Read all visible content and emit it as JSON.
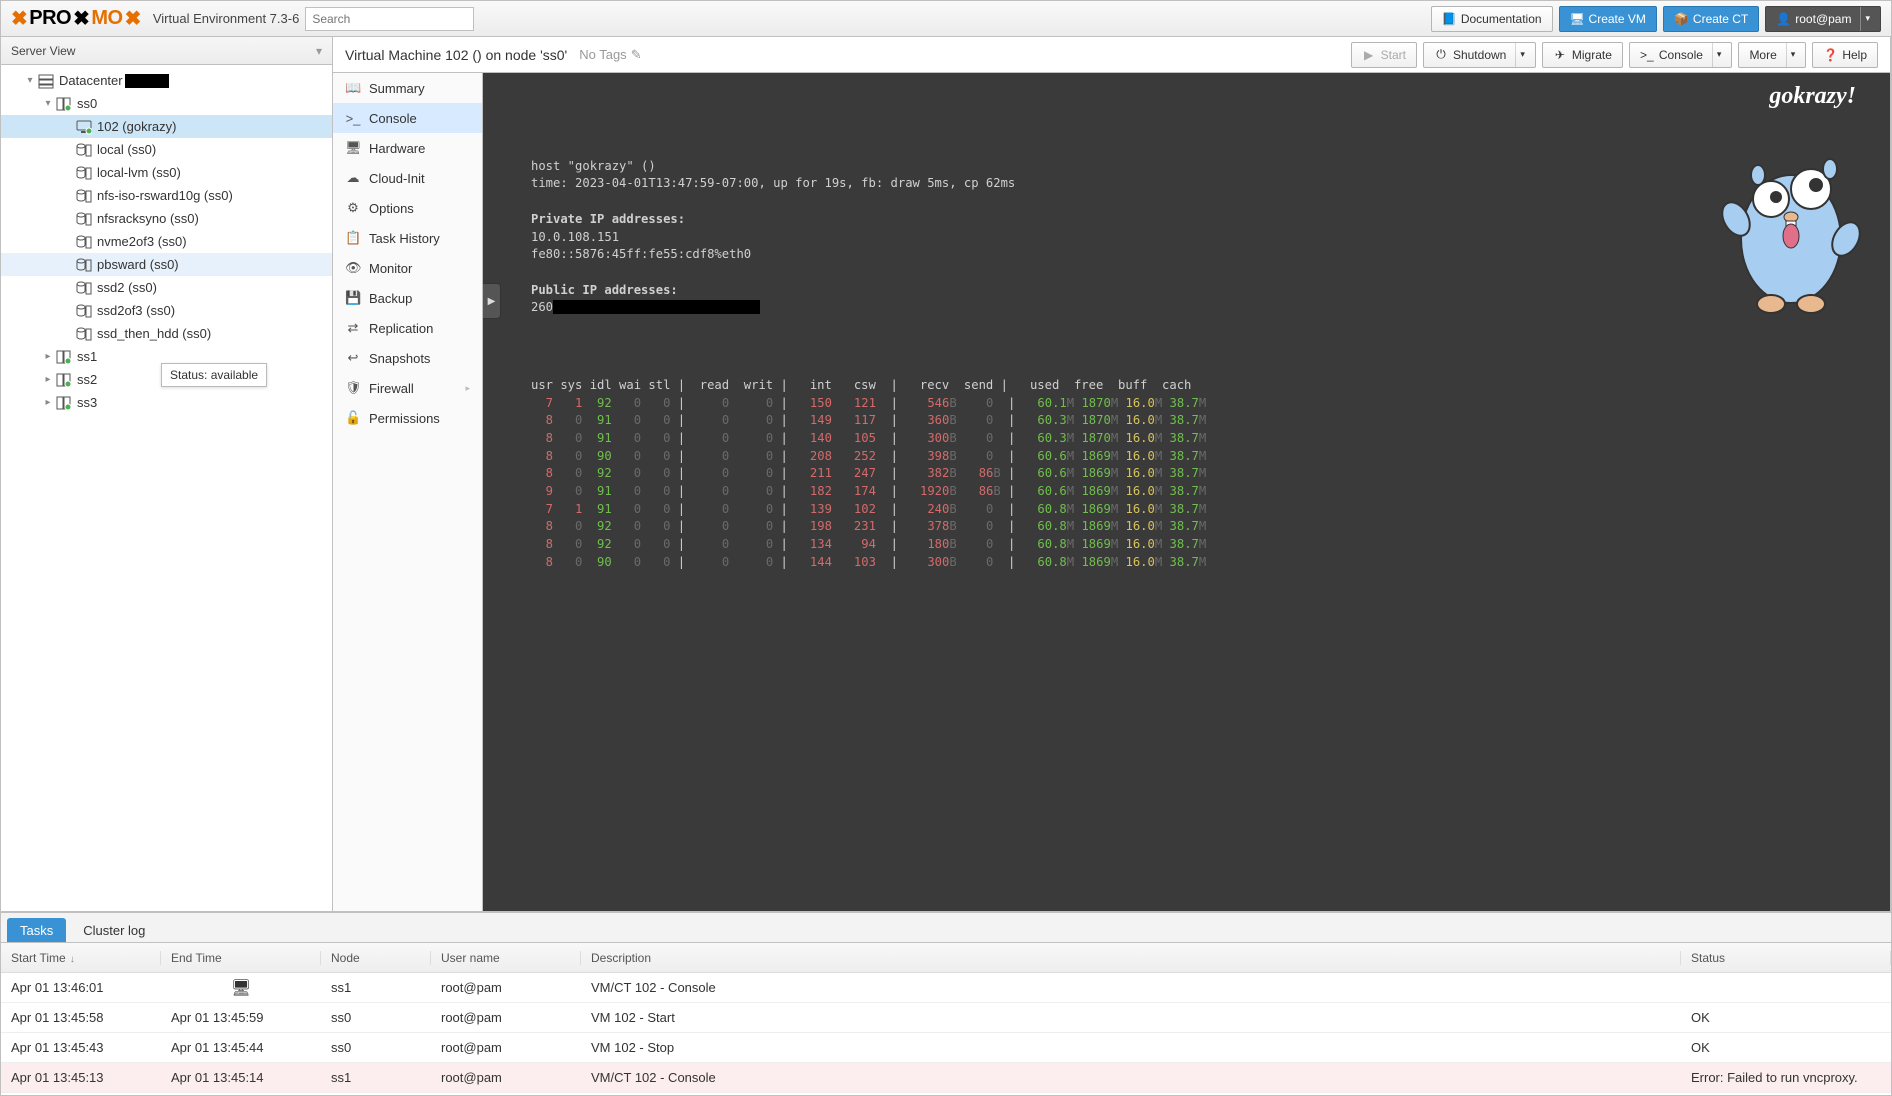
{
  "topbar": {
    "brand_pro": "PRO",
    "brand_mo": "MO",
    "sub": "Virtual Environment 7.3-6",
    "search_placeholder": "Search",
    "doc_btn": "Documentation",
    "create_vm": "Create VM",
    "create_ct": "Create CT",
    "user_btn": "root@pam"
  },
  "leftpane": {
    "header": "Server View",
    "tooltip": "Status: available",
    "tree": [
      {
        "level": 1,
        "expand": "▾",
        "icon": "datacenter",
        "label": "Datacenter",
        "redact": true
      },
      {
        "level": 2,
        "expand": "▾",
        "icon": "node",
        "label": "ss0",
        "hl": false
      },
      {
        "level": 3,
        "expand": "",
        "icon": "vm",
        "label": "102 (gokrazy)",
        "sel": true
      },
      {
        "level": 3,
        "expand": "",
        "icon": "storage",
        "label": "local (ss0)"
      },
      {
        "level": 3,
        "expand": "",
        "icon": "storage",
        "label": "local-lvm (ss0)"
      },
      {
        "level": 3,
        "expand": "",
        "icon": "storage",
        "label": "nfs-iso-rsward10g (ss0)"
      },
      {
        "level": 3,
        "expand": "",
        "icon": "storage",
        "label": "nfsracksyno (ss0)"
      },
      {
        "level": 3,
        "expand": "",
        "icon": "storage",
        "label": "nvme2of3 (ss0)"
      },
      {
        "level": 3,
        "expand": "",
        "icon": "storage",
        "label": "pbsward (ss0)",
        "hl": true
      },
      {
        "level": 3,
        "expand": "",
        "icon": "storage",
        "label": "ssd2 (ss0)"
      },
      {
        "level": 3,
        "expand": "",
        "icon": "storage",
        "label": "ssd2of3 (ss0)"
      },
      {
        "level": 3,
        "expand": "",
        "icon": "storage",
        "label": "ssd_then_hdd (ss0)"
      },
      {
        "level": 2,
        "expand": "▸",
        "icon": "node",
        "label": "ss1"
      },
      {
        "level": 2,
        "expand": "▸",
        "icon": "node",
        "label": "ss2"
      },
      {
        "level": 2,
        "expand": "▸",
        "icon": "node",
        "label": "ss3"
      }
    ]
  },
  "centerheader": {
    "title": "Virtual Machine 102 () on node 'ss0'",
    "tags": "No Tags",
    "actions": {
      "start": "Start",
      "shutdown": "Shutdown",
      "migrate": "Migrate",
      "console": "Console",
      "more": "More",
      "help": "Help"
    }
  },
  "subnav": [
    {
      "icon": "📖",
      "label": "Summary"
    },
    {
      "icon": ">_",
      "label": "Console",
      "sel": true
    },
    {
      "icon": "🖥",
      "label": "Hardware"
    },
    {
      "icon": "☁",
      "label": "Cloud-Init"
    },
    {
      "icon": "⚙",
      "label": "Options"
    },
    {
      "icon": "📋",
      "label": "Task History"
    },
    {
      "icon": "👁",
      "label": "Monitor"
    },
    {
      "icon": "💾",
      "label": "Backup"
    },
    {
      "icon": "⇄",
      "label": "Replication"
    },
    {
      "icon": "↩",
      "label": "Snapshots"
    },
    {
      "icon": "🛡",
      "label": "Firewall",
      "caret": true
    },
    {
      "icon": "🔓",
      "label": "Permissions"
    }
  ],
  "console": {
    "brand": "gokrazy!",
    "host_line": "host \"gokrazy\" ()",
    "time_line": "time: 2023-04-01T13:47:59-07:00, up for 19s, fb: draw 5ms, cp 62ms",
    "priv_hdr": "Private IP addresses:",
    "priv_ip1": "10.0.108.151",
    "priv_ip2": "fe80::5876:45ff:fe55:cdf8%eth0",
    "pub_hdr": "Public IP addresses:",
    "pub_ip1_prefix": "260",
    "stats_header": "usr sys idl wai stl |  read  writ |   int   csw  |   recv  send |   used  free  buff  cach",
    "rows": [
      {
        "usr": "7",
        "sys": "1",
        "idl": "92",
        "wai": "0",
        "stl": "0",
        "read": "0",
        "writ": "0",
        "int": "150",
        "csw": "121",
        "recv": "546",
        "recvB": "B",
        "send": "0",
        "used": "60.1",
        "usedM": "M",
        "free": "1870",
        "freeM": "M",
        "buff": "16.0",
        "buffM": "M",
        "cach": "38.7",
        "cachM": "M"
      },
      {
        "usr": "8",
        "sys": "0",
        "idl": "91",
        "wai": "0",
        "stl": "0",
        "read": "0",
        "writ": "0",
        "int": "149",
        "csw": "117",
        "recv": "360",
        "recvB": "B",
        "send": "0",
        "used": "60.3",
        "usedM": "M",
        "free": "1870",
        "freeM": "M",
        "buff": "16.0",
        "buffM": "M",
        "cach": "38.7",
        "cachM": "M"
      },
      {
        "usr": "8",
        "sys": "0",
        "idl": "91",
        "wai": "0",
        "stl": "0",
        "read": "0",
        "writ": "0",
        "int": "140",
        "csw": "105",
        "recv": "300",
        "recvB": "B",
        "send": "0",
        "used": "60.3",
        "usedM": "M",
        "free": "1870",
        "freeM": "M",
        "buff": "16.0",
        "buffM": "M",
        "cach": "38.7",
        "cachM": "M"
      },
      {
        "usr": "8",
        "sys": "0",
        "idl": "90",
        "wai": "0",
        "stl": "0",
        "read": "0",
        "writ": "0",
        "int": "208",
        "csw": "252",
        "recv": "398",
        "recvB": "B",
        "send": "0",
        "used": "60.6",
        "usedM": "M",
        "free": "1869",
        "freeM": "M",
        "buff": "16.0",
        "buffM": "M",
        "cach": "38.7",
        "cachM": "M"
      },
      {
        "usr": "8",
        "sys": "0",
        "idl": "92",
        "wai": "0",
        "stl": "0",
        "read": "0",
        "writ": "0",
        "int": "211",
        "csw": "247",
        "recv": "382",
        "recvB": "B",
        "send": "86",
        "sendB": "B",
        "used": "60.6",
        "usedM": "M",
        "free": "1869",
        "freeM": "M",
        "buff": "16.0",
        "buffM": "M",
        "cach": "38.7",
        "cachM": "M"
      },
      {
        "usr": "9",
        "sys": "0",
        "idl": "91",
        "wai": "0",
        "stl": "0",
        "read": "0",
        "writ": "0",
        "int": "182",
        "csw": "174",
        "recv": "1920",
        "recvB": "B",
        "send": "86",
        "sendB": "B",
        "used": "60.6",
        "usedM": "M",
        "free": "1869",
        "freeM": "M",
        "buff": "16.0",
        "buffM": "M",
        "cach": "38.7",
        "cachM": "M"
      },
      {
        "usr": "7",
        "sys": "1",
        "idl": "91",
        "wai": "0",
        "stl": "0",
        "read": "0",
        "writ": "0",
        "int": "139",
        "csw": "102",
        "recv": "240",
        "recvB": "B",
        "send": "0",
        "used": "60.8",
        "usedM": "M",
        "free": "1869",
        "freeM": "M",
        "buff": "16.0",
        "buffM": "M",
        "cach": "38.7",
        "cachM": "M"
      },
      {
        "usr": "8",
        "sys": "0",
        "idl": "92",
        "wai": "0",
        "stl": "0",
        "read": "0",
        "writ": "0",
        "int": "198",
        "csw": "231",
        "recv": "378",
        "recvB": "B",
        "send": "0",
        "used": "60.8",
        "usedM": "M",
        "free": "1869",
        "freeM": "M",
        "buff": "16.0",
        "buffM": "M",
        "cach": "38.7",
        "cachM": "M"
      },
      {
        "usr": "8",
        "sys": "0",
        "idl": "92",
        "wai": "0",
        "stl": "0",
        "read": "0",
        "writ": "0",
        "int": "134",
        "csw": "94",
        "recv": "180",
        "recvB": "B",
        "send": "0",
        "used": "60.8",
        "usedM": "M",
        "free": "1869",
        "freeM": "M",
        "buff": "16.0",
        "buffM": "M",
        "cach": "38.7",
        "cachM": "M"
      },
      {
        "usr": "8",
        "sys": "0",
        "idl": "90",
        "wai": "0",
        "stl": "0",
        "read": "0",
        "writ": "0",
        "int": "144",
        "csw": "103",
        "recv": "300",
        "recvB": "B",
        "send": "0",
        "used": "60.8",
        "usedM": "M",
        "free": "1869",
        "freeM": "M",
        "buff": "16.0",
        "buffM": "M",
        "cach": "38.7",
        "cachM": "M"
      }
    ]
  },
  "bottom": {
    "tab_tasks": "Tasks",
    "tab_cluster": "Cluster log",
    "cols": {
      "start": "Start Time",
      "end": "End Time",
      "node": "Node",
      "user": "User name",
      "desc": "Description",
      "stat": "Status"
    },
    "rows": [
      {
        "start": "Apr 01 13:46:01",
        "end": "",
        "end_icon": "🖥",
        "node": "ss1",
        "user": "root@pam",
        "desc": "VM/CT 102 - Console",
        "stat": ""
      },
      {
        "start": "Apr 01 13:45:58",
        "end": "Apr 01 13:45:59",
        "node": "ss0",
        "user": "root@pam",
        "desc": "VM 102 - Start",
        "stat": "OK"
      },
      {
        "start": "Apr 01 13:45:43",
        "end": "Apr 01 13:45:44",
        "node": "ss0",
        "user": "root@pam",
        "desc": "VM 102 - Stop",
        "stat": "OK"
      },
      {
        "start": "Apr 01 13:45:13",
        "end": "Apr 01 13:45:14",
        "node": "ss1",
        "user": "root@pam",
        "desc": "VM/CT 102 - Console",
        "stat": "Error: Failed to run vncproxy.",
        "err": true
      }
    ]
  }
}
